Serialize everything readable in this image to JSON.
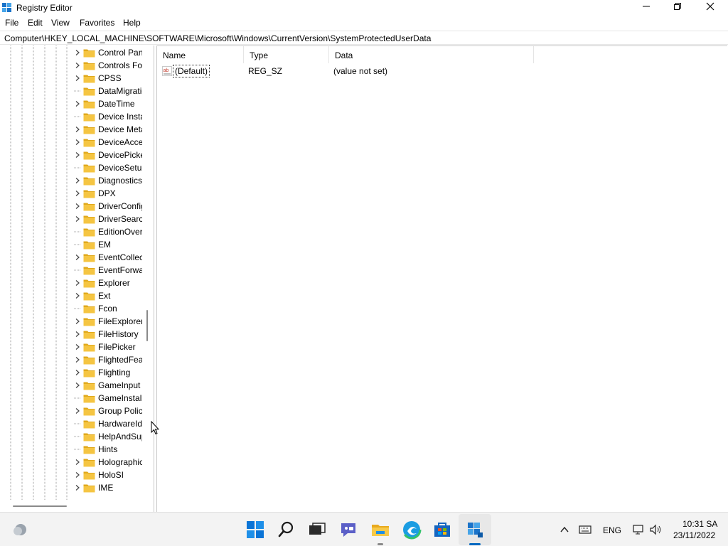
{
  "window": {
    "title": "Registry Editor",
    "controls": {
      "minimize": "—",
      "restore": "❐",
      "close": "✕"
    }
  },
  "menu": [
    "File",
    "Edit",
    "View",
    "Favorites",
    "Help"
  ],
  "address_path": "Computer\\HKEY_LOCAL_MACHINE\\SOFTWARE\\Microsoft\\Windows\\CurrentVersion\\SystemProtectedUserData",
  "tree": {
    "items": [
      {
        "label": "Control Panel",
        "expandable": true
      },
      {
        "label": "Controls Folder",
        "expandable": true
      },
      {
        "label": "CPSS",
        "expandable": true
      },
      {
        "label": "DataMigration",
        "expandable": false
      },
      {
        "label": "DateTime",
        "expandable": true
      },
      {
        "label": "Device Installer",
        "expandable": false
      },
      {
        "label": "Device Metadata",
        "expandable": true
      },
      {
        "label": "DeviceAccess",
        "expandable": true
      },
      {
        "label": "DevicePicker",
        "expandable": true
      },
      {
        "label": "DeviceSetup",
        "expandable": false
      },
      {
        "label": "Diagnostics",
        "expandable": true
      },
      {
        "label": "DPX",
        "expandable": true
      },
      {
        "label": "DriverConfiguration",
        "expandable": true
      },
      {
        "label": "DriverSearching",
        "expandable": true
      },
      {
        "label": "EditionOverrides",
        "expandable": false
      },
      {
        "label": "EM",
        "expandable": false
      },
      {
        "label": "EventCollector",
        "expandable": true
      },
      {
        "label": "EventForwarding",
        "expandable": false
      },
      {
        "label": "Explorer",
        "expandable": true
      },
      {
        "label": "Ext",
        "expandable": true
      },
      {
        "label": "Fcon",
        "expandable": false
      },
      {
        "label": "FileExplorer",
        "expandable": true
      },
      {
        "label": "FileHistory",
        "expandable": true
      },
      {
        "label": "FilePicker",
        "expandable": true
      },
      {
        "label": "FlightedFeatures",
        "expandable": true
      },
      {
        "label": "Flighting",
        "expandable": true
      },
      {
        "label": "GameInput",
        "expandable": true
      },
      {
        "label": "GameInstaller",
        "expandable": false
      },
      {
        "label": "Group Policy",
        "expandable": true
      },
      {
        "label": "HardwareIdentification",
        "expandable": false
      },
      {
        "label": "HelpAndSupport",
        "expandable": false
      },
      {
        "label": "Hints",
        "expandable": false
      },
      {
        "label": "Holographic",
        "expandable": true
      },
      {
        "label": "HoloSI",
        "expandable": true
      },
      {
        "label": "IME",
        "expandable": true
      }
    ]
  },
  "list": {
    "columns": [
      "Name",
      "Type",
      "Data"
    ],
    "rows": [
      {
        "name": "(Default)",
        "type": "REG_SZ",
        "data": "(value not set)"
      }
    ]
  },
  "taskbar": {
    "language": "ENG",
    "time": "10:31 SA",
    "date": "23/11/2022"
  },
  "colors": {
    "folder": "#f5c542",
    "folder_dark": "#e0a91c",
    "accent": "#0067c0"
  }
}
